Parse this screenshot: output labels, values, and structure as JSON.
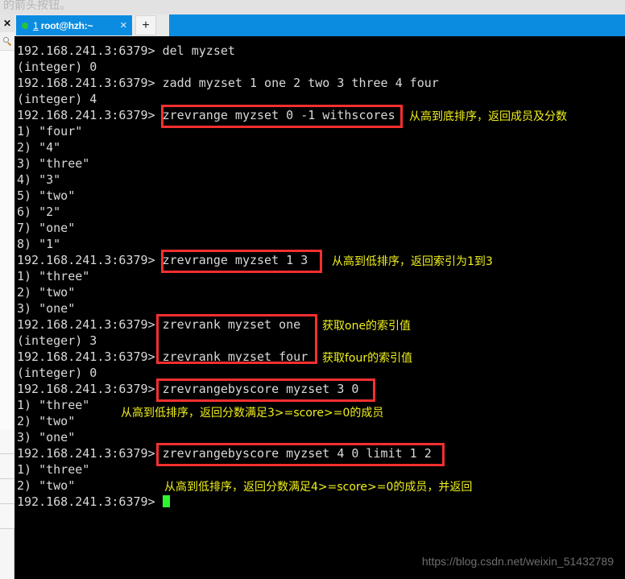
{
  "page": {
    "cut_text": "的箭头按钮。",
    "watermark": "https://blog.csdn.net/weixin_51432789"
  },
  "left_toolbar": {
    "close_label": "✕",
    "search_icon_name": "search-icon"
  },
  "tabbar": {
    "tab": {
      "number": "1",
      "title": "root@hzh:~",
      "close_label": "✕",
      "status_dot_color": "#27c23c",
      "active_color": "#0c8ce0"
    },
    "new_tab_label": "+"
  },
  "terminal": {
    "prompt": "192.168.241.3:6379>",
    "background": "#000000",
    "foreground": "#d9d9d9",
    "cursor_color": "#2ff52f",
    "lines": [
      "192.168.241.3:6379> del myzset",
      "(integer) 0",
      "192.168.241.3:6379> zadd myzset 1 one 2 two 3 three 4 four",
      "(integer) 4",
      "192.168.241.3:6379> zrevrange myzset 0 -1 withscores",
      "1) \"four\"",
      "2) \"4\"",
      "3) \"three\"",
      "4) \"3\"",
      "5) \"two\"",
      "6) \"2\"",
      "7) \"one\"",
      "8) \"1\"",
      "192.168.241.3:6379> zrevrange myzset 1 3",
      "1) \"three\"",
      "2) \"two\"",
      "3) \"one\"",
      "192.168.241.3:6379> zrevrank myzset one",
      "(integer) 3",
      "192.168.241.3:6379> zrevrank myzset four",
      "(integer) 0",
      "192.168.241.3:6379> zrevrangebyscore myzset 3 0",
      "1) \"three\"",
      "2) \"two\"",
      "3) \"one\"",
      "192.168.241.3:6379> zrevrangebyscore myzset 4 0 limit 1 2",
      "1) \"three\"",
      "2) \"two\"",
      "192.168.241.3:6379> "
    ]
  },
  "annotations": {
    "highlight_color": "#f62f2f",
    "note_color": "#f1f11c",
    "notes": [
      "从高到底排序，返回成员及分数",
      "从高到低排序，返回索引为1到3",
      "获取one的索引值",
      "获取four的索引值",
      "从高到低排序，返回分数满足3>=score>=0的成员",
      "从高到低排序，返回分数满足4>=score>=0的成员，并返回"
    ]
  }
}
